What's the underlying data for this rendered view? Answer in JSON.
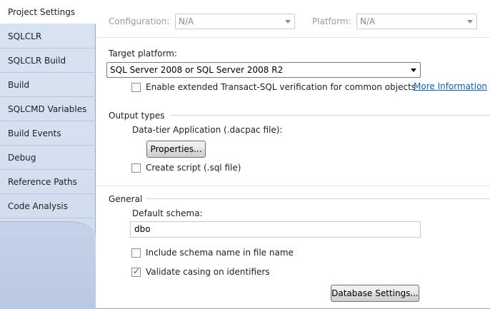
{
  "sidebar": {
    "tabs": [
      {
        "label": "Project Settings",
        "selected": true
      },
      {
        "label": "SQLCLR"
      },
      {
        "label": "SQLCLR Build"
      },
      {
        "label": "Build"
      },
      {
        "label": "SQLCMD Variables"
      },
      {
        "label": "Build Events"
      },
      {
        "label": "Debug"
      },
      {
        "label": "Reference Paths"
      },
      {
        "label": "Code Analysis"
      }
    ]
  },
  "config": {
    "configuration_label": "Configuration:",
    "configuration_value": "N/A",
    "platform_label": "Platform:",
    "platform_value": "N/A"
  },
  "target": {
    "label": "Target platform:",
    "value": "SQL Server 2008 or SQL Server 2008 R2",
    "extended_verification_label": "Enable extended Transact-SQL verification for common objects",
    "extended_verification_checked": false,
    "more_info_link": "More Information"
  },
  "output": {
    "heading": "Output types",
    "dacpac_label": "Data-tier Application (.dacpac file):",
    "properties_button": "Properties...",
    "create_script_label": "Create script (.sql file)",
    "create_script_checked": false
  },
  "general": {
    "heading": "General",
    "default_schema_label": "Default schema:",
    "default_schema_value": "dbo",
    "include_schema_label": "Include schema name in file name",
    "include_schema_checked": false,
    "validate_casing_label": "Validate casing on identifiers",
    "validate_casing_checked": true,
    "database_settings_button": "Database Settings..."
  }
}
